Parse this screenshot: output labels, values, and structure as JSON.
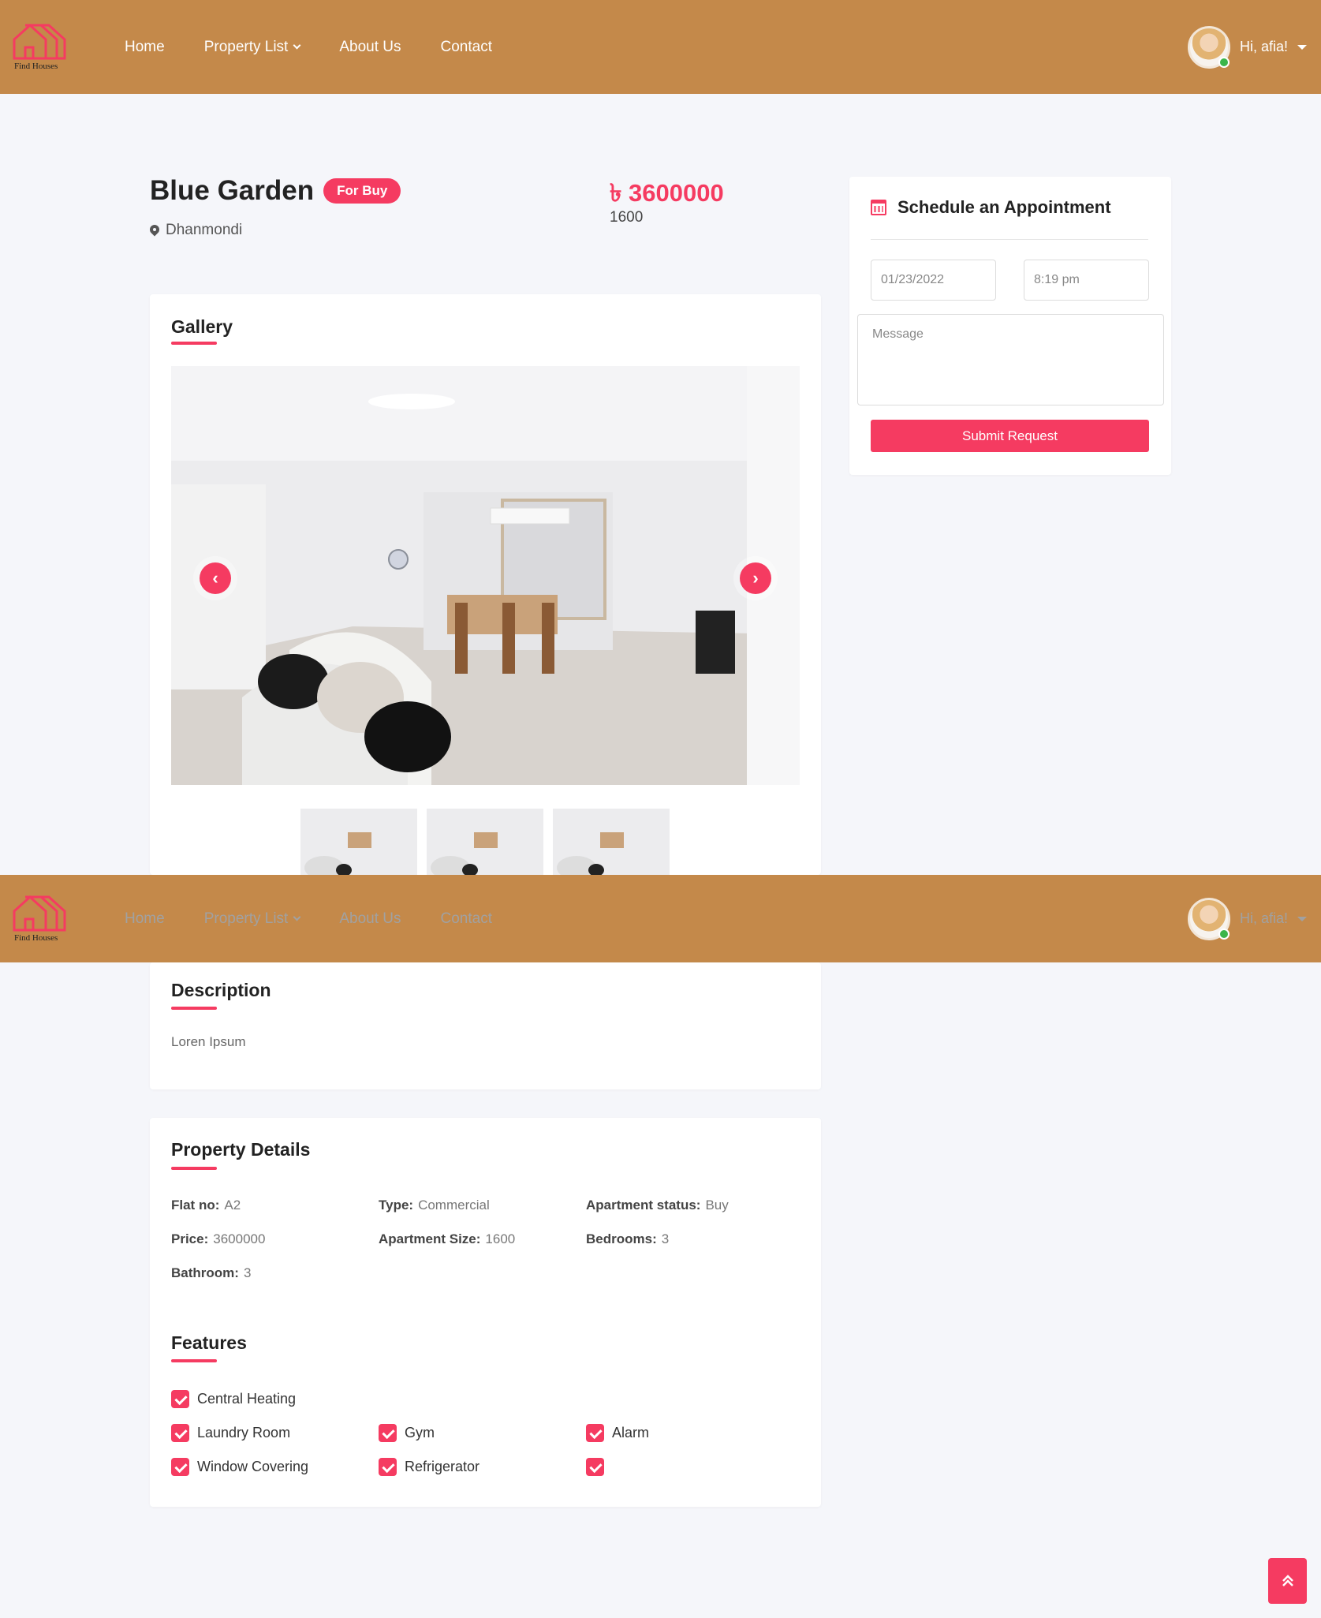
{
  "brand": {
    "name": "Find Houses",
    "accent": "#f53b61",
    "header_bg": "#c4894a"
  },
  "nav": {
    "items": [
      "Home",
      "Property List",
      "About Us",
      "Contact"
    ],
    "greeting": "Hi, afia!"
  },
  "property": {
    "title": "Blue Garden",
    "badge": "For Buy",
    "location": "Dhanmondi",
    "price": "৳ 3600000",
    "size": "1600"
  },
  "gallery": {
    "heading": "Gallery"
  },
  "description": {
    "heading": "Description",
    "text": "Loren Ipsum"
  },
  "details": {
    "heading": "Property Details",
    "rows": [
      {
        "label": "Flat no:",
        "value": "A2"
      },
      {
        "label": "Type:",
        "value": "Commercial"
      },
      {
        "label": "Apartment status:",
        "value": "Buy"
      },
      {
        "label": "Price:",
        "value": "3600000"
      },
      {
        "label": "Apartment Size:",
        "value": "1600"
      },
      {
        "label": "Bedrooms:",
        "value": "3"
      },
      {
        "label": "Bathroom:",
        "value": "3"
      }
    ]
  },
  "features": {
    "heading": "Features",
    "items": [
      "Central Heating",
      "Laundry Room",
      "Gym",
      "Alarm",
      "Window Covering",
      "Refrigerator",
      ""
    ]
  },
  "appointment": {
    "title": "Schedule an Appointment",
    "date_value": "01/23/2022",
    "time_value": "8:19 pm",
    "message_placeholder": "Message",
    "submit_label": "Submit Request"
  }
}
